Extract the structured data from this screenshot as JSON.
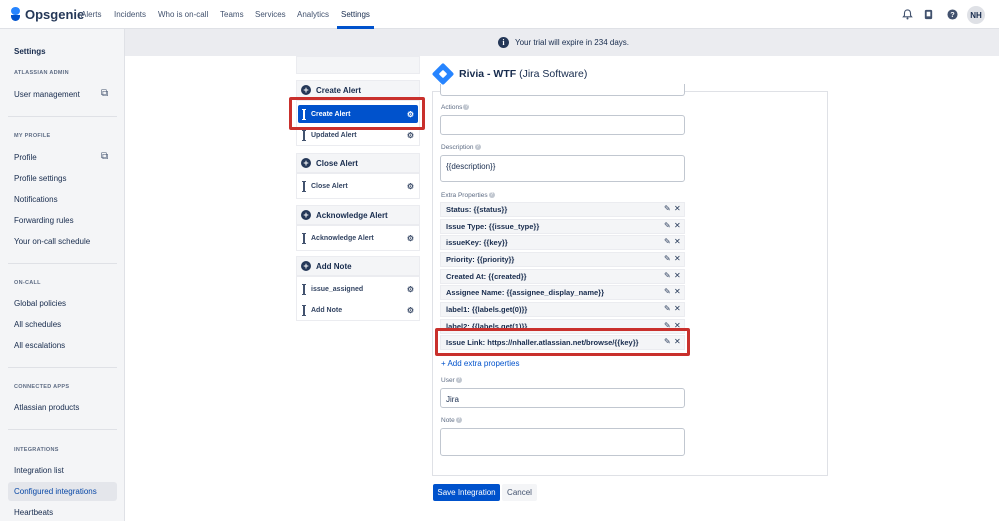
{
  "app": {
    "name": "Opsgenie"
  },
  "nav": {
    "items": [
      "Alerts",
      "Incidents",
      "Who is on-call",
      "Teams",
      "Services",
      "Analytics",
      "Settings"
    ],
    "active": "Settings",
    "icons": [
      "bell-icon",
      "mobile-icon",
      "help-icon"
    ],
    "user_initials": "NH"
  },
  "sidebar": {
    "title": "Settings",
    "sections": {
      "atlassian_admin": "ATLASSIAN ADMIN",
      "my_profile": "MY PROFILE",
      "on_call": "ON-CALL",
      "connected_apps": "CONNECTED APPS",
      "integrations": "INTEGRATIONS"
    },
    "items": {
      "user_management": "User management",
      "profile": "Profile",
      "profile_settings": "Profile settings",
      "notifications": "Notifications",
      "forwarding_rules": "Forwarding rules",
      "on_call_schedule": "Your on-call schedule",
      "global_policies": "Global policies",
      "all_schedules": "All schedules",
      "all_escalations": "All escalations",
      "atlassian_products": "Atlassian products",
      "integration_list": "Integration list",
      "configured_integrations": "Configured integrations",
      "heartbeats": "Heartbeats"
    },
    "selected": "Configured integrations"
  },
  "banner": {
    "icon": "info-icon",
    "text": "Your trial will expire in 234 days."
  },
  "action_groups": [
    {
      "title": "Create Alert",
      "actions": [
        "Create Alert",
        "Updated Alert"
      ]
    },
    {
      "title": "Close Alert",
      "actions": [
        "Close Alert"
      ]
    },
    {
      "title": "Acknowledge Alert",
      "actions": [
        "Acknowledge Alert"
      ]
    },
    {
      "title": "Add Note",
      "actions": [
        "issue_assigned",
        "Add Note"
      ]
    }
  ],
  "selected_action": "Create Alert",
  "integration": {
    "name": "Rivia - WTF",
    "type": "(Jira Software)"
  },
  "form": {
    "actions_label": "Actions",
    "actions_value": "",
    "description_label": "Description",
    "description_value": "{{description}}",
    "extra_properties_label": "Extra Properties",
    "extra_properties": [
      "Status: {{status}}",
      "Issue Type: {{issue_type}}",
      "issueKey: {{key}}",
      "Priority: {{priority}}",
      "Created At: {{created}}",
      "Assignee Name: {{assignee_display_name}}",
      "label1: {{labels.get(0)}}",
      "label2: {{labels.get(1)}}",
      "Issue Link: https://nhaller.atlassian.net/browse/{{key}}"
    ],
    "add_extra_label": "+ Add extra properties",
    "user_label": "User",
    "user_value": "Jira",
    "note_label": "Note",
    "note_value": ""
  },
  "buttons": {
    "save": "Save Integration",
    "cancel": "Cancel"
  },
  "colors": {
    "primary": "#0052cc",
    "highlight": "#c9302c",
    "brand": "#2684ff"
  }
}
